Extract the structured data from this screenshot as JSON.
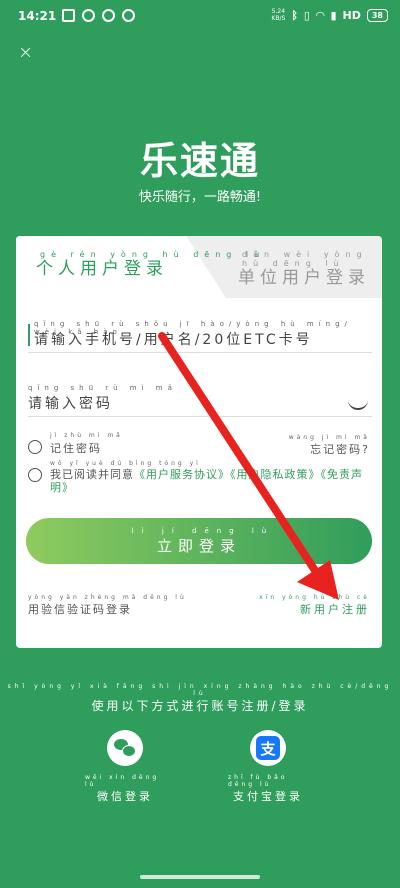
{
  "status_bar": {
    "time": "14:21",
    "network_speed": "5.24",
    "network_unit": "KB/S",
    "network_type": "HD",
    "battery": "38"
  },
  "close_label": "×",
  "header": {
    "app_title": "乐速通",
    "slogan": "快乐随行，一路畅通!"
  },
  "tabs": {
    "personal": {
      "pinyin": "gè rén yòng hù dēng lù",
      "label": "个人用户登录"
    },
    "unit": {
      "pinyin": "dān wèi yòng hù dēng lù",
      "label": "单位用户登录"
    }
  },
  "form": {
    "account_pinyin": "qǐng shū rù shǒu jī hào/yòng hù míng/ wèi kǎ hào",
    "account_placeholder": "请输入手机号/用户名/20位ETC卡号",
    "password_pinyin": "qǐng shū rù mì mǎ",
    "password_placeholder": "请输入密码",
    "remember_pinyin": "jì zhù mì mǎ",
    "remember_label": "记住密码",
    "forgot_pinyin": "wàng jì mì mǎ",
    "forgot_label": "忘记密码?",
    "agree_pinyin": "wǒ yǐ yuè dú bìng tóng yì",
    "agree_prefix": "我已阅读并同意",
    "agree_service": "《用户服务协议》",
    "agree_privacy": "《用户隐私政策》",
    "agree_disclaimer": "《免责声明》",
    "login_pinyin": "lì jí dēng lù",
    "login_label": "立即登录",
    "sms_pinyin": "yòng yàn zhèng mǎ dēng lù",
    "sms_label": "用验信验证码登录",
    "register_pinyin": "xīn yòng hù zhù cè",
    "register_label": "新用户注册"
  },
  "other": {
    "pinyin": "shǐ yòng yǐ xià fāng shì jìn xíng zhàng hào zhù cè/dēng lù",
    "label": "使用以下方式进行账号注册/登录",
    "wechat_pinyin": "wēi xìn dēng lù",
    "wechat_label": "微信登录",
    "alipay_pinyin": "zhī fù bǎo dēng lù",
    "alipay_label": "支付宝登录",
    "alipay_glyph": "支"
  },
  "colors": {
    "brand_green": "#2f9d5c",
    "arrow_red": "#e8221e",
    "alipay_blue": "#1677ff"
  },
  "icons": [
    "close-icon",
    "eye-closed-icon",
    "wechat-icon",
    "alipay-icon"
  ]
}
